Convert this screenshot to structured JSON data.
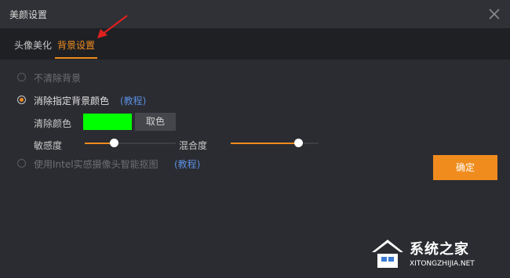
{
  "window": {
    "title": "美颜设置",
    "close_icon": "close-icon"
  },
  "tabs": [
    {
      "label": "头像美化",
      "active": false
    },
    {
      "label": "背景设置",
      "active": true
    }
  ],
  "options": {
    "no_clear": {
      "label": "不清除背景",
      "selected": false,
      "enabled": false
    },
    "clear_color": {
      "label": "消除指定背景颜色",
      "tutorial": "(教程)",
      "selected": true
    },
    "intel": {
      "label": "使用Intel实感摄像头智能抠图",
      "tutorial": "(教程)",
      "selected": false,
      "enabled": false
    }
  },
  "clear_color": {
    "label": "清除颜色",
    "swatch_color": "#00ff00",
    "pick_button": "取色"
  },
  "sliders": {
    "sensitivity": {
      "label": "敏感度",
      "value": 0.32
    },
    "blend": {
      "label": "混合度",
      "value": 0.77
    }
  },
  "confirm_button": "确定",
  "watermark": {
    "text": "系统之家",
    "url": "XITONGZHIJIA.NET"
  },
  "colors": {
    "accent": "#f08c1e",
    "background": "#2b2c31",
    "link": "#5a8ee0"
  }
}
